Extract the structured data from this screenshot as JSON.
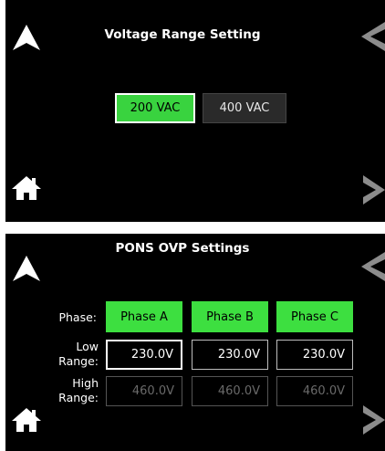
{
  "voltage_screen": {
    "title": "Voltage Range Setting",
    "options": [
      "200 VAC",
      "400 VAC"
    ],
    "selected_option": "200 VAC",
    "icons": {
      "up": "up-arrow-icon",
      "left": "left-chevron-icon",
      "right": "right-chevron-icon",
      "home": "home-icon"
    }
  },
  "ovp_screen": {
    "title": "PONS OVP Settings",
    "phase_label": "Phase:",
    "low_label_line1": "Low",
    "low_label_line2": "Range:",
    "high_label_line1": "High",
    "high_label_line2": "Range:",
    "phases": [
      "Phase A",
      "Phase B",
      "Phase C"
    ],
    "low_values": [
      "230.0V",
      "230.0V",
      "230.0V"
    ],
    "high_values": [
      "460.0V",
      "460.0V",
      "460.0V"
    ],
    "colors": {
      "accent_green": "#3ddf40",
      "disabled_text": "#6a6a6a"
    }
  }
}
